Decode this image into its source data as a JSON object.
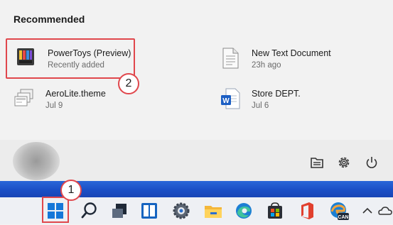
{
  "start_menu": {
    "recommended_heading": "Recommended",
    "items": [
      {
        "name": "PowerToys (Preview)",
        "detail": "Recently added",
        "icon": "powertoys-icon"
      },
      {
        "name": "New Text Document",
        "detail": "23h ago",
        "icon": "text-document-icon"
      },
      {
        "name": "AeroLite.theme",
        "detail": "Jul 9",
        "icon": "theme-file-icon"
      },
      {
        "name": "Store DEPT.",
        "detail": "Jul 6",
        "icon": "word-document-icon"
      }
    ],
    "footer_buttons": [
      "file-explorer-icon",
      "settings-gear-icon",
      "power-icon"
    ]
  },
  "callouts": {
    "step1": "1",
    "step2": "2"
  },
  "taskbar": {
    "buttons": [
      "start",
      "search",
      "task-view",
      "widgets",
      "settings",
      "file-explorer",
      "edge",
      "store",
      "office",
      "edge-canary"
    ],
    "canary_label": "CAN",
    "tray": [
      "chevron-up-icon",
      "cloud-icon"
    ]
  },
  "colors": {
    "annotation_red": "#e0474c",
    "wallpaper_blue": "#1b4fc6",
    "start_blue": "#0f6cbd"
  }
}
